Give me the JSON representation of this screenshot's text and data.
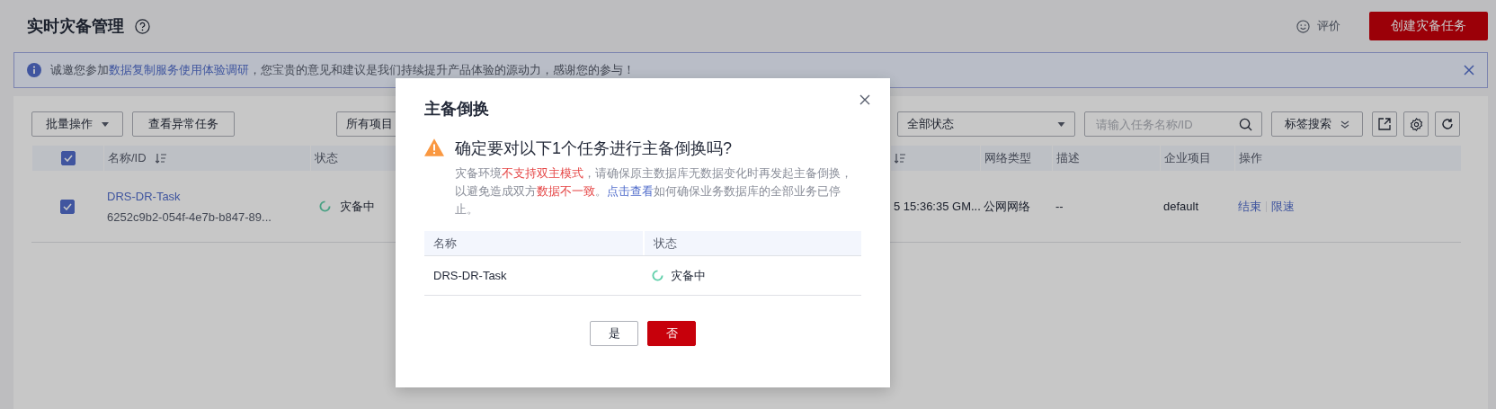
{
  "page": {
    "title": "实时灾备管理",
    "feedback": "评价",
    "create_button": "创建灾备任务"
  },
  "notice": {
    "before": "诚邀您参加",
    "link": "数据复制服务使用体验调研",
    "after": "，您宝贵的意见和建议是我们持续提升产品体验的源动力，感谢您的参与！"
  },
  "toolbar": {
    "batch": "批量操作",
    "abnormal": "查看异常任务",
    "project": "所有项目",
    "status": "全部状态",
    "search_placeholder": "请输入任务名称/ID",
    "tag_search": "标签搜索"
  },
  "table": {
    "all_checked": true,
    "columns": [
      {
        "label": "名称/ID",
        "sort": true
      },
      {
        "label": "状态",
        "sort": false
      },
      {
        "sort": true
      },
      {
        "label": "网络类型",
        "sort": false
      },
      {
        "label": "描述",
        "sort": false
      },
      {
        "label": "企业项目",
        "sort": false
      },
      {
        "label": "操作",
        "sort": false
      }
    ],
    "rows": [
      {
        "checked": true,
        "name": "DRS-DR-Task",
        "id": "6252c9b2-054f-4e7b-b847-89...",
        "status": "灾备中",
        "column_3": "5 15:36:35 GM...",
        "network": "公网网络",
        "description": "--",
        "project": "default",
        "actions": [
          "结束",
          "限速"
        ]
      }
    ]
  },
  "modal": {
    "title": "主备倒换",
    "question": "确定要对以下1个任务进行主备倒换吗?",
    "message": [
      {
        "kind": "plain",
        "text": "灾备环境"
      },
      {
        "kind": "danger",
        "text": "不支持双主模式"
      },
      {
        "kind": "plain",
        "text": "，请确保原主数据库无数据变化时再发起主备倒换，以避免造成双方"
      },
      {
        "kind": "danger",
        "text": "数据不一致"
      },
      {
        "kind": "plain",
        "text": "。"
      },
      {
        "kind": "link",
        "text": "点击查看"
      },
      {
        "kind": "plain",
        "text": "如何确保业务数据库的全部业务已停止。"
      }
    ],
    "columns": [
      "名称",
      "状态"
    ],
    "rows": [
      {
        "name": "DRS-DR-Task",
        "status": "灾备中"
      }
    ],
    "buttons": [
      {
        "label": "是",
        "primary": false
      },
      {
        "label": "否",
        "primary": true
      }
    ]
  }
}
